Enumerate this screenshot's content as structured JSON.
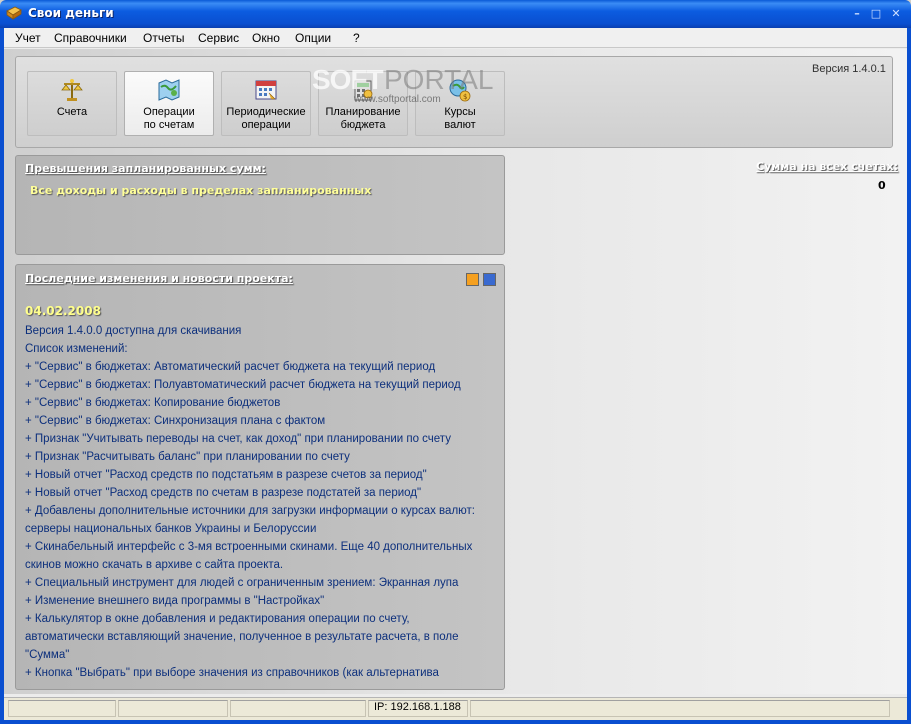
{
  "window": {
    "title": "Свои деньги"
  },
  "menu": [
    "Учет",
    "Справочники",
    "Отчеты",
    "Сервис",
    "Окно",
    "Опции",
    "?"
  ],
  "toolbar": {
    "buttons": [
      {
        "line1": "Счета",
        "line2": ""
      },
      {
        "line1": "Операции",
        "line2": "по счетам"
      },
      {
        "line1": "Периодические",
        "line2": "операции"
      },
      {
        "line1": "Планирование",
        "line2": "бюджета"
      },
      {
        "line1": "Курсы",
        "line2": "валют"
      }
    ],
    "version": "Версия 1.4.0.1"
  },
  "watermark": {
    "soft": "SOFT",
    "portal": "PORTAL",
    "url": "www.softportal.com"
  },
  "exceed_panel": {
    "title": "Превышения запланированных сумм:",
    "message": "Все доходы и расходы в пределах запланированных"
  },
  "sum_panel": {
    "title": "Сумма на всех счетах:",
    "value": "0"
  },
  "news_panel": {
    "title": "Последние изменения и новости проекта:",
    "date": "04.02.2008",
    "lines": [
      "Версия 1.4.0.0 доступна для скачивания",
      "Список изменений:",
      "+ \"Сервис\" в бюджетах: Автоматический расчет бюджета на текущий период",
      "+ \"Сервис\" в бюджетах: Полуавтоматический расчет бюджета на текущий период",
      "+ \"Сервис\" в бюджетах: Копирование бюджетов",
      "+ \"Сервис\" в бюджетах: Синхронизация плана с фактом",
      "+ Признак \"Учитывать переводы на счет, как доход\" при планировании по счету",
      "+ Признак \"Расчитывать баланс\" при планировании по счету",
      "+ Новый отчет \"Расход средств по подстатьям в разрезе счетов за период\"",
      "+ Новый отчет \"Расход средств по счетам в разрезе подстатей за период\"",
      "+ Добавлены дополнительные источники для загрузки информации о курсах валют:",
      "серверы национальных банков Украины и Белоруссии",
      "+ Скинабельный интерфейс с 3-мя встроенными скинами. Еще 40 дополнительных",
      "скинов можно скачать  в архиве с сайта проекта.",
      "+ Специальный инструмент для людей с ограниченным зрением: Экранная лупа",
      "+ Изменение внешнего вида программы в \"Настройках\"",
      "+ Калькулятор в окне добавления и редактирования операции по счету,",
      "автоматически вставляющий значение, полученное в результате расчета, в поле",
      "\"Сумма\"",
      "+ Кнопка \"Выбрать\" при выборе значения из справочников (как альтернатива"
    ]
  },
  "statusbar": {
    "ip": "IP: 192.168.1.188"
  },
  "colors": {
    "title_bar": "#0c5ce0",
    "news_text": "#0c2f7c",
    "highlight_text": "#ffff9a"
  }
}
